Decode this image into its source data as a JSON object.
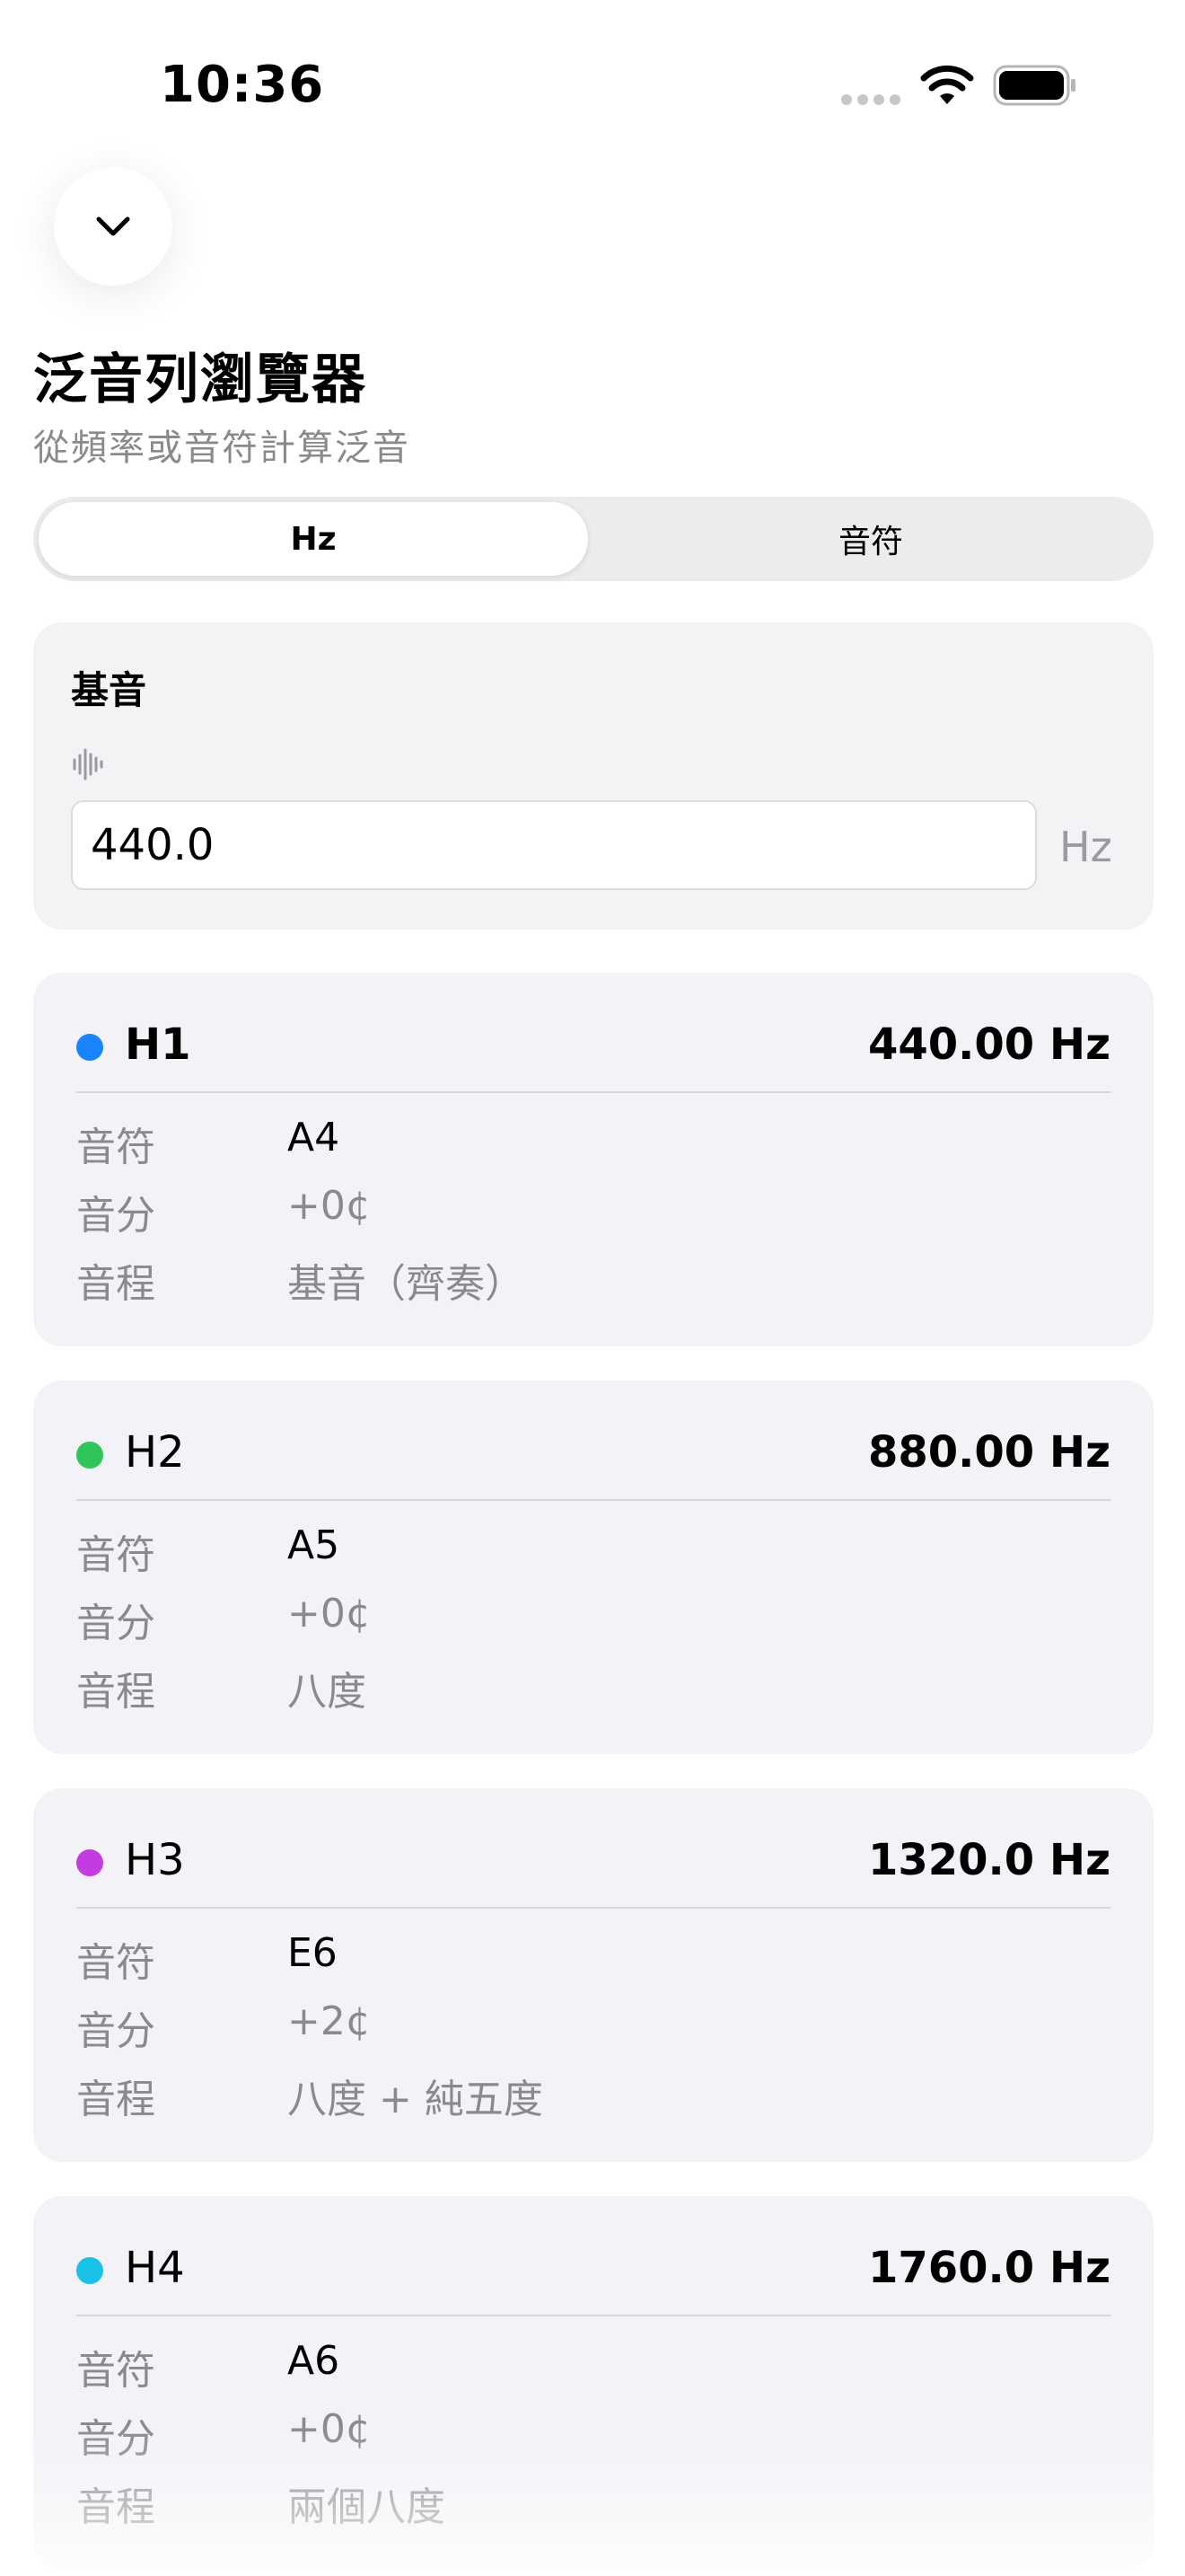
{
  "status_bar": {
    "time": "10:36"
  },
  "header": {
    "title": "泛音列瀏覽器",
    "subtitle": "從頻率或音符計算泛音"
  },
  "segmented": {
    "options": [
      "Hz",
      "音符"
    ],
    "selected": "Hz"
  },
  "fundamental": {
    "label": "基音",
    "value": "440.0",
    "unit": "Hz"
  },
  "row_labels": {
    "note": "音符",
    "cents": "音分",
    "interval": "音程"
  },
  "harmonics": [
    {
      "label": "H1",
      "frequency": "440.00 Hz",
      "note": "A4",
      "cents": "+0¢",
      "interval": "基音（齊奏）",
      "dot_color": "#1a84ff"
    },
    {
      "label": "H2",
      "frequency": "880.00 Hz",
      "note": "A5",
      "cents": "+0¢",
      "interval": "八度",
      "dot_color": "#30c55a"
    },
    {
      "label": "H3",
      "frequency": "1320.0 Hz",
      "note": "E6",
      "cents": "+2¢",
      "interval": "八度 + 純五度",
      "dot_color": "#c43be0"
    },
    {
      "label": "H4",
      "frequency": "1760.0 Hz",
      "note": "A6",
      "cents": "+0¢",
      "interval": "兩個八度",
      "dot_color": "#18c1e6"
    }
  ]
}
